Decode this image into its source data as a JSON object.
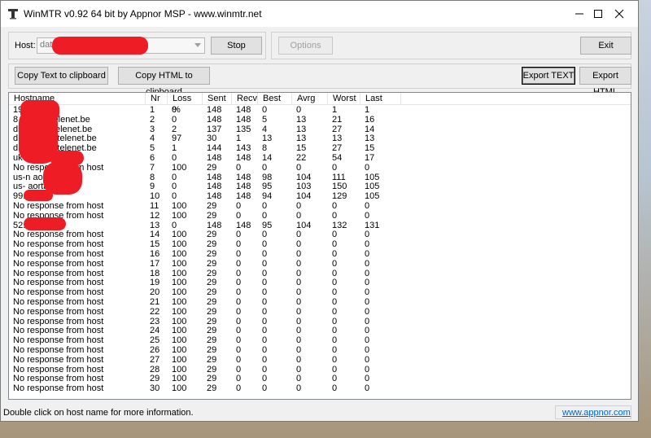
{
  "window": {
    "title": "WinMTR v0.92 64 bit by Appnor MSP - www.winmtr.net"
  },
  "host": {
    "label": "Host:",
    "value": "dataro"
  },
  "buttons": {
    "stop": "Stop",
    "options": "Options",
    "exit": "Exit",
    "copy_text": "Copy Text to clipboard",
    "copy_html": "Copy HTML to clipboard",
    "export_text": "Export TEXT",
    "export_html": "Export HTML"
  },
  "columns": [
    "Hostname",
    "Nr",
    "Loss %",
    "Sent",
    "Recv",
    "Best",
    "Avrg",
    "Worst",
    "Last"
  ],
  "rows": [
    {
      "hostname": "19",
      "nr": "1",
      "loss": "0",
      "sent": "148",
      "recv": "148",
      "best": "0",
      "avrg": "0",
      "worst": "1",
      "last": "1"
    },
    {
      "hostname": "8          access.telenet.be",
      "nr": "2",
      "loss": "0",
      "sent": "148",
      "recv": "148",
      "best": "5",
      "avrg": "13",
      "worst": "21",
      "last": "16"
    },
    {
      "hostname": "dl         access.telenet.be",
      "nr": "3",
      "loss": "2",
      "sent": "137",
      "recv": "135",
      "best": "4",
      "avrg": "13",
      "worst": "27",
      "last": "14"
    },
    {
      "hostname": "dD         access.telenet.be",
      "nr": "4",
      "loss": "97",
      "sent": "30",
      "recv": "1",
      "best": "13",
      "avrg": "13",
      "worst": "13",
      "last": "13"
    },
    {
      "hostname": "dD         access.telenet.be",
      "nr": "5",
      "loss": "1",
      "sent": "144",
      "recv": "143",
      "best": "8",
      "avrg": "15",
      "worst": "27",
      "last": "15"
    },
    {
      "hostname": "uk-lo              aorta.net",
      "nr": "6",
      "loss": "0",
      "sent": "148",
      "recv": "148",
      "best": "14",
      "avrg": "22",
      "worst": "54",
      "last": "17"
    },
    {
      "hostname": "No response from host",
      "nr": "7",
      "loss": "100",
      "sent": "29",
      "recv": "0",
      "best": "0",
      "avrg": "0",
      "worst": "0",
      "last": "0"
    },
    {
      "hostname": "us-n                 aorta.net",
      "nr": "8",
      "loss": "0",
      "sent": "148",
      "recv": "148",
      "best": "98",
      "avrg": "104",
      "worst": "111",
      "last": "105"
    },
    {
      "hostname": "us-               aorta.net",
      "nr": "9",
      "loss": "0",
      "sent": "148",
      "recv": "148",
      "best": "95",
      "avrg": "103",
      "worst": "150",
      "last": "105"
    },
    {
      "hostname": "99.8",
      "nr": "10",
      "loss": "0",
      "sent": "148",
      "recv": "148",
      "best": "94",
      "avrg": "104",
      "worst": "129",
      "last": "105"
    },
    {
      "hostname": "No response from host",
      "nr": "11",
      "loss": "100",
      "sent": "29",
      "recv": "0",
      "best": "0",
      "avrg": "0",
      "worst": "0",
      "last": "0"
    },
    {
      "hostname": "No response from host",
      "nr": "12",
      "loss": "100",
      "sent": "29",
      "recv": "0",
      "best": "0",
      "avrg": "0",
      "worst": "0",
      "last": "0"
    },
    {
      "hostname": "52.",
      "nr": "13",
      "loss": "0",
      "sent": "148",
      "recv": "148",
      "best": "95",
      "avrg": "104",
      "worst": "132",
      "last": "131"
    },
    {
      "hostname": "No response from host",
      "nr": "14",
      "loss": "100",
      "sent": "29",
      "recv": "0",
      "best": "0",
      "avrg": "0",
      "worst": "0",
      "last": "0"
    },
    {
      "hostname": "No response from host",
      "nr": "15",
      "loss": "100",
      "sent": "29",
      "recv": "0",
      "best": "0",
      "avrg": "0",
      "worst": "0",
      "last": "0"
    },
    {
      "hostname": "No response from host",
      "nr": "16",
      "loss": "100",
      "sent": "29",
      "recv": "0",
      "best": "0",
      "avrg": "0",
      "worst": "0",
      "last": "0"
    },
    {
      "hostname": "No response from host",
      "nr": "17",
      "loss": "100",
      "sent": "29",
      "recv": "0",
      "best": "0",
      "avrg": "0",
      "worst": "0",
      "last": "0"
    },
    {
      "hostname": "No response from host",
      "nr": "18",
      "loss": "100",
      "sent": "29",
      "recv": "0",
      "best": "0",
      "avrg": "0",
      "worst": "0",
      "last": "0"
    },
    {
      "hostname": "No response from host",
      "nr": "19",
      "loss": "100",
      "sent": "29",
      "recv": "0",
      "best": "0",
      "avrg": "0",
      "worst": "0",
      "last": "0"
    },
    {
      "hostname": "No response from host",
      "nr": "20",
      "loss": "100",
      "sent": "29",
      "recv": "0",
      "best": "0",
      "avrg": "0",
      "worst": "0",
      "last": "0"
    },
    {
      "hostname": "No response from host",
      "nr": "21",
      "loss": "100",
      "sent": "29",
      "recv": "0",
      "best": "0",
      "avrg": "0",
      "worst": "0",
      "last": "0"
    },
    {
      "hostname": "No response from host",
      "nr": "22",
      "loss": "100",
      "sent": "29",
      "recv": "0",
      "best": "0",
      "avrg": "0",
      "worst": "0",
      "last": "0"
    },
    {
      "hostname": "No response from host",
      "nr": "23",
      "loss": "100",
      "sent": "29",
      "recv": "0",
      "best": "0",
      "avrg": "0",
      "worst": "0",
      "last": "0"
    },
    {
      "hostname": "No response from host",
      "nr": "24",
      "loss": "100",
      "sent": "29",
      "recv": "0",
      "best": "0",
      "avrg": "0",
      "worst": "0",
      "last": "0"
    },
    {
      "hostname": "No response from host",
      "nr": "25",
      "loss": "100",
      "sent": "29",
      "recv": "0",
      "best": "0",
      "avrg": "0",
      "worst": "0",
      "last": "0"
    },
    {
      "hostname": "No response from host",
      "nr": "26",
      "loss": "100",
      "sent": "29",
      "recv": "0",
      "best": "0",
      "avrg": "0",
      "worst": "0",
      "last": "0"
    },
    {
      "hostname": "No response from host",
      "nr": "27",
      "loss": "100",
      "sent": "29",
      "recv": "0",
      "best": "0",
      "avrg": "0",
      "worst": "0",
      "last": "0"
    },
    {
      "hostname": "No response from host",
      "nr": "28",
      "loss": "100",
      "sent": "29",
      "recv": "0",
      "best": "0",
      "avrg": "0",
      "worst": "0",
      "last": "0"
    },
    {
      "hostname": "No response from host",
      "nr": "29",
      "loss": "100",
      "sent": "29",
      "recv": "0",
      "best": "0",
      "avrg": "0",
      "worst": "0",
      "last": "0"
    },
    {
      "hostname": "No response from host",
      "nr": "30",
      "loss": "100",
      "sent": "29",
      "recv": "0",
      "best": "0",
      "avrg": "0",
      "worst": "0",
      "last": "0"
    }
  ],
  "status": {
    "text": "Double click on host name for more information.",
    "link": "www.appnor.com"
  },
  "icons": {
    "app": "winmtr-app-icon",
    "minimize": "minimize-icon",
    "maximize": "maximize-icon",
    "close": "close-icon",
    "combo": "chevron-down-icon"
  },
  "colors": {
    "redaction": "#ee1c24",
    "link": "#0066cc"
  }
}
